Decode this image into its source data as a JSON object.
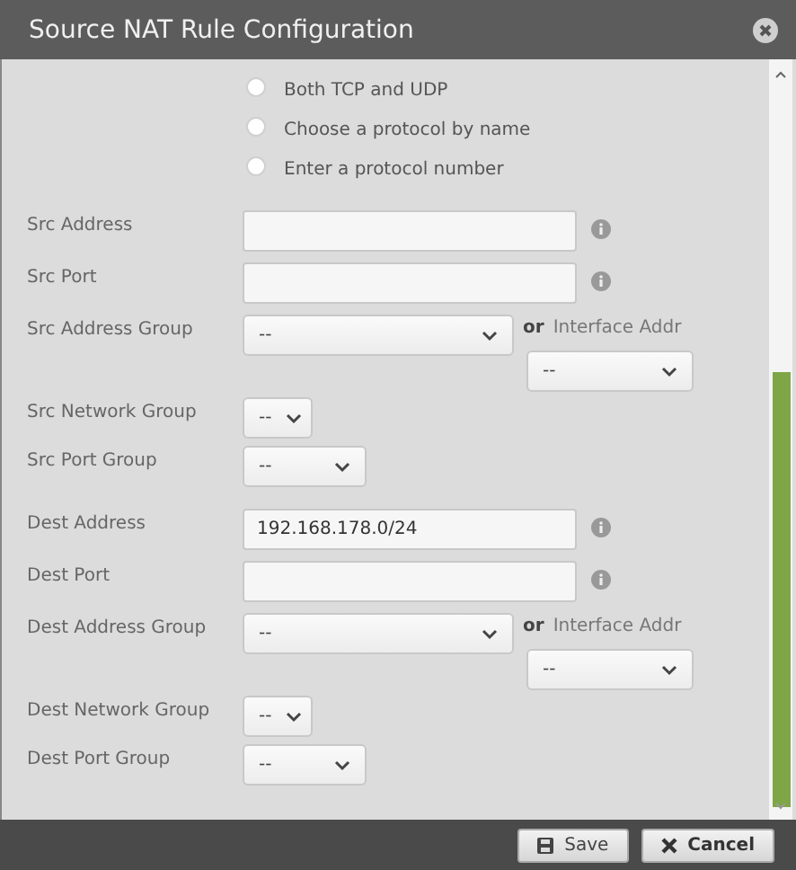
{
  "window": {
    "title": "Source NAT Rule Configuration"
  },
  "protocol_options": [
    {
      "label": "Both TCP and UDP",
      "selected": false
    },
    {
      "label": "Choose a protocol by name",
      "selected": false
    },
    {
      "label": "Enter a protocol number",
      "selected": false
    }
  ],
  "fields": [
    {
      "kind": "text",
      "label": "Src Address"
    },
    {
      "kind": "text",
      "label": "Src Port"
    },
    {
      "kind": "select_or",
      "label": "Src Address Group",
      "value": "--",
      "or": "or",
      "alt_label": "Interface Addr",
      "alt_value": "--"
    },
    {
      "kind": "select_small",
      "label": "Src Network Group",
      "value": "--"
    },
    {
      "kind": "select_medium",
      "label": "Src Port Group",
      "value": "--"
    },
    {
      "kind": "text",
      "label": "Dest Address",
      "value": "192.168.178.0/24"
    },
    {
      "kind": "text",
      "label": "Dest Port"
    },
    {
      "kind": "select_or",
      "label": "Dest Address Group",
      "value": "--",
      "or": "or",
      "alt_label": "Interface Addr",
      "alt_value": "--"
    },
    {
      "kind": "select_small",
      "label": "Dest Network Group",
      "value": "--"
    },
    {
      "kind": "select_medium",
      "label": "Dest Port Group",
      "value": "--"
    }
  ],
  "buttons": [
    {
      "kind": "save",
      "label": "Save"
    },
    {
      "kind": "cancel",
      "label": "Cancel"
    }
  ]
}
